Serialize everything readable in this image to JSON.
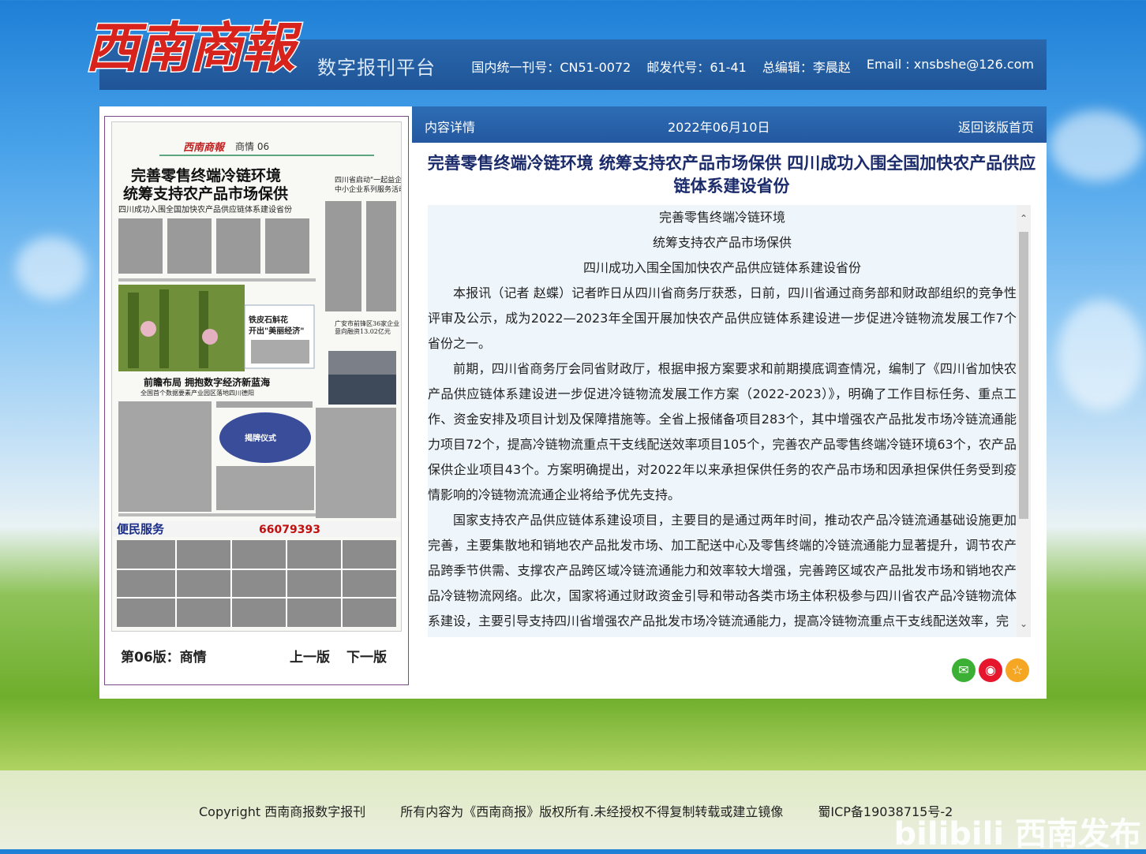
{
  "header": {
    "logo_text": "西南商報",
    "platform_name": "数字报刊平台",
    "cn_number": "国内统一刊号：CN51-0072",
    "postal_code": "邮发代号：61-41",
    "editor": "总编辑：李晨赵",
    "email": "Email : xnsbshe@126.com"
  },
  "paper": {
    "masthead": "西南商報",
    "section": "商情 06",
    "headline1": "完善零售终端冷链环境",
    "headline2": "统筹支持农产品市场保供",
    "subhead": "四川成功入围全国加快农产品供应链体系建设省份",
    "side_headline1": "四川省启动\"一起益企\"",
    "side_headline2": "中小企业系列服务活动",
    "photo_caption1": "铁皮石斛花",
    "photo_caption2": "开出\"美丽经济\"",
    "side_headline3": "广安市前锋区36家企业",
    "side_headline4": "意向融资13.02亿元",
    "story2_head": "前瞻布局  拥抱数字经济新蓝海",
    "story2_sub": "全国首个数据要素产业园区落地四川德阳",
    "ceremony_text": "揭牌仪式",
    "ad_title": "便民服务",
    "ad_phone": "66079393",
    "edition_label": "第06版：商情",
    "prev_label": "上一版",
    "next_label": "下一版"
  },
  "content": {
    "bar_title": "内容详情",
    "date": "2022年06月10日",
    "back_link": "返回该版首页",
    "headline": "完善零售终端冷链环境 统筹支持农产品市场保供 四川成功入围全国加快农产品供应链体系建设省份",
    "sub1": "完善零售终端冷链环境",
    "sub2": "统筹支持农产品市场保供",
    "sub3": "四川成功入围全国加快农产品供应链体系建设省份",
    "para1": "本报讯（记者 赵蝶）记者昨日从四川省商务厅获悉，日前，四川省通过商务部和财政部组织的竞争性评审及公示，成为2022—2023年全国开展加快农产品供应链体系建设进一步促进冷链物流发展工作7个省份之一。",
    "para2": "前期，四川省商务厅会同省财政厅，根据申报方案要求和前期摸底调查情况，编制了《四川省加快农产品供应链体系建设进一步促进冷链物流发展工作方案（2022-2023）》，明确了工作目标任务、重点工作、资金安排及项目计划及保障措施等。全省上报储备项目283个，其中增强农产品批发市场冷链流通能力项目72个，提高冷链物流重点干支线配送效率项目105个，完善农产品零售终端冷链环境63个，农产品保供企业项目43个。方案明确提出，对2022年以来承担保供任务的农产品市场和因承担保供任务受到疫情影响的冷链物流流通企业将给予优先支持。",
    "para3": "国家支持农产品供应链体系建设项目，主要目的是通过两年时间，推动农产品冷链流通基础设施更加完善，主要集散地和销地农产品批发市场、加工配送中心及零售终端的冷链流通能力显著提升，调节农产品跨季节供需、支撑农产品跨区域冷链流通能力和效率较大增强，完善跨区域农产品批发市场和销地农产品冷链物流网络。此次，国家将通过财政资金引导和带动各类市场主体积极参与四川省农产品冷链物流体系建设，主要引导支持四川省增强农产品批发市场冷链流通能力，提高冷链物流重点干支线配送效率，完",
    "scroll_up": "⌃",
    "scroll_down": "⌄"
  },
  "share": {
    "wechat_color": "#3cb034",
    "weibo_color": "#e6162d",
    "favorite_color": "#f5a623"
  },
  "footer": {
    "copyright": "Copyright 西南商报数字报刊",
    "rights": "所有内容为《西南商报》版权所有.未经授权不得复制转载或建立镜像",
    "icp": "蜀ICP备19038715号-2",
    "watermark": "bilibili 西南发布"
  }
}
